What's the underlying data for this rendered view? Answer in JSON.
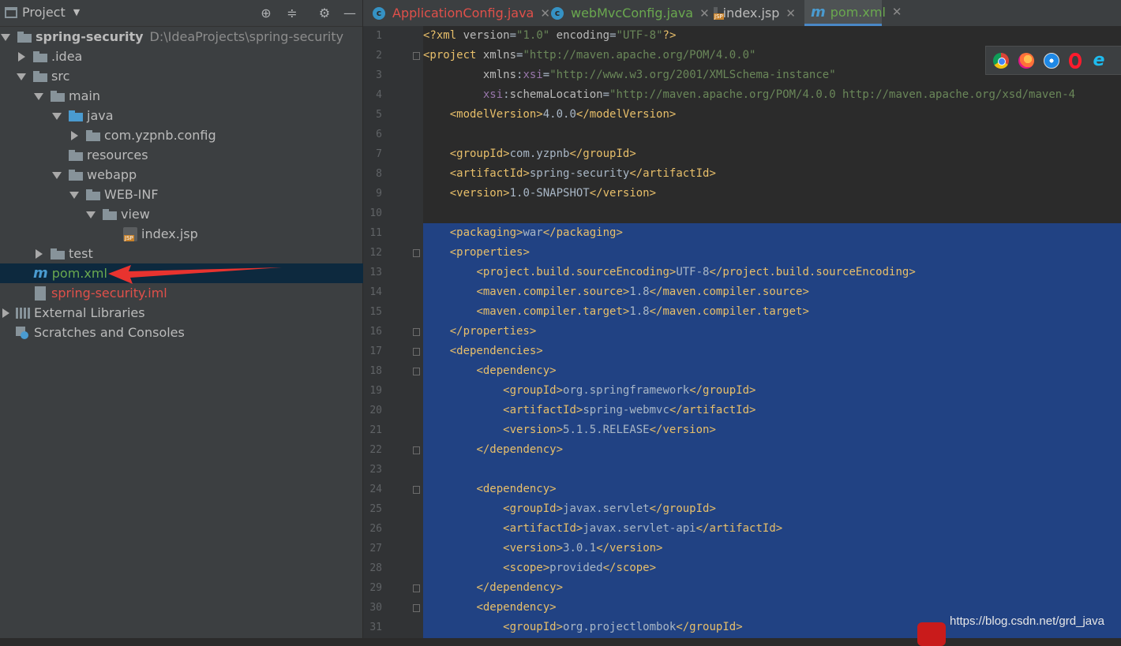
{
  "project_panel": {
    "title": "Project",
    "tree": [
      {
        "label": "spring-security",
        "hint": "D:\\IdeaProjects\\spring-security"
      },
      {
        "label": ".idea"
      },
      {
        "label": "src"
      },
      {
        "label": "main"
      },
      {
        "label": "java"
      },
      {
        "label": "com.yzpnb.config"
      },
      {
        "label": "resources"
      },
      {
        "label": "webapp"
      },
      {
        "label": "WEB-INF"
      },
      {
        "label": "view"
      },
      {
        "label": "index.jsp"
      },
      {
        "label": "test"
      },
      {
        "label": "pom.xml"
      },
      {
        "label": "spring-security.iml"
      },
      {
        "label": "External Libraries"
      },
      {
        "label": "Scratches and Consoles"
      }
    ]
  },
  "tabs": [
    {
      "label": "ApplicationConfig.java",
      "color": "#e0504a"
    },
    {
      "label": "webMvcConfig.java",
      "color": "#6aa84f"
    },
    {
      "label": "index.jsp",
      "color": "#bbbbbb"
    },
    {
      "label": "pom.xml",
      "color": "#6aa84f"
    }
  ],
  "code": {
    "line_numbers": [
      "1",
      "2",
      "3",
      "4",
      "5",
      "6",
      "7",
      "8",
      "9",
      "10",
      "11",
      "12",
      "13",
      "14",
      "15",
      "16",
      "17",
      "18",
      "19",
      "20",
      "21",
      "22",
      "23",
      "24",
      "25",
      "26",
      "27",
      "28",
      "29",
      "30",
      "31"
    ],
    "lines": [
      {
        "t": "<?xml version=\"1.0\" encoding=\"UTF-8\"?>"
      },
      {
        "t": "<project xmlns=\"http://maven.apache.org/POM/4.0.0\""
      },
      {
        "t": "         xmlns:xsi=\"http://www.w3.org/2001/XMLSchema-instance\""
      },
      {
        "t": "         xsi:schemaLocation=\"http://maven.apache.org/POM/4.0.0 http://maven.apache.org/xsd/maven-4"
      },
      {
        "t": "    <modelVersion>4.0.0</modelVersion>"
      },
      {
        "t": ""
      },
      {
        "t": "    <groupId>com.yzpnb</groupId>"
      },
      {
        "t": "    <artifactId>spring-security</artifactId>"
      },
      {
        "t": "    <version>1.0-SNAPSHOT</version>"
      },
      {
        "t": ""
      },
      {
        "t": "    <packaging>war</packaging>"
      },
      {
        "t": "    <properties>"
      },
      {
        "t": "        <project.build.sourceEncoding>UTF-8</project.build.sourceEncoding>"
      },
      {
        "t": "        <maven.compiler.source>1.8</maven.compiler.source>"
      },
      {
        "t": "        <maven.compiler.target>1.8</maven.compiler.target>"
      },
      {
        "t": "    </properties>"
      },
      {
        "t": "    <dependencies>"
      },
      {
        "t": "        <dependency>"
      },
      {
        "t": "            <groupId>org.springframework</groupId>"
      },
      {
        "t": "            <artifactId>spring-webmvc</artifactId>"
      },
      {
        "t": "            <version>5.1.5.RELEASE</version>"
      },
      {
        "t": "        </dependency>"
      },
      {
        "t": ""
      },
      {
        "t": "        <dependency>"
      },
      {
        "t": "            <groupId>javax.servlet</groupId>"
      },
      {
        "t": "            <artifactId>javax.servlet-api</artifactId>"
      },
      {
        "t": "            <version>3.0.1</version>"
      },
      {
        "t": "            <scope>provided</scope>"
      },
      {
        "t": "        </dependency>"
      },
      {
        "t": "        <dependency>"
      },
      {
        "t": "            <groupId>org.projectlombok</groupId>"
      }
    ]
  },
  "browsers": [
    "chrome-icon",
    "firefox-icon",
    "safari-icon",
    "opera-icon",
    "ie-icon"
  ],
  "watermark": "https://blog.csdn.net/grd_java"
}
